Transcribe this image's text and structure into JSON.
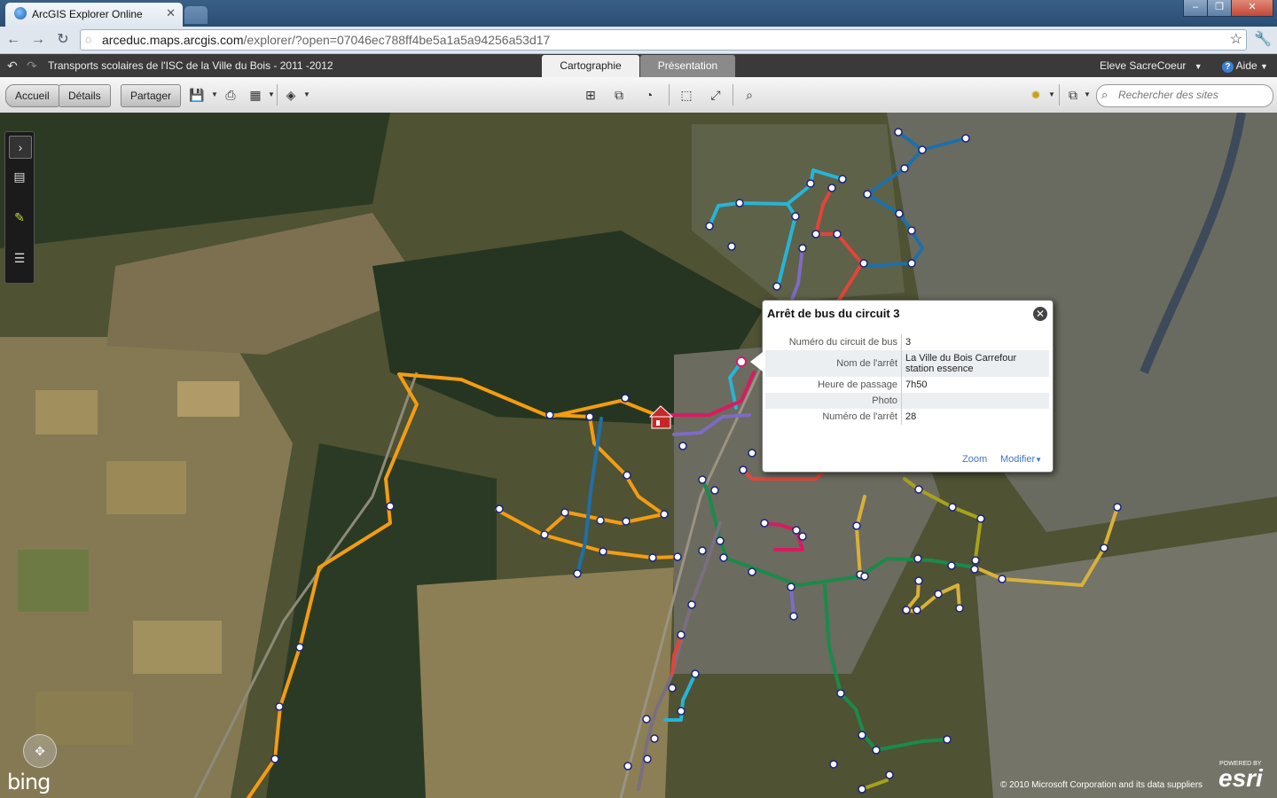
{
  "browser": {
    "tab_title": "ArcGIS Explorer Online",
    "url_host": "arceduc.maps.arcgis.com",
    "url_path": "/explorer/?open=07046ec788ff4be5a1a5a94256a53d17"
  },
  "app": {
    "title": "Transports scolaires de l'ISC de la Ville du Bois - 2011 -2012",
    "tabs": [
      "Cartographie",
      "Présentation"
    ],
    "active_tab": "Cartographie",
    "user": "Eleve SacreCoeur",
    "help": "Aide"
  },
  "toolbar": {
    "home": "Accueil",
    "details": "Détails",
    "share": "Partager",
    "search_placeholder": "Rechercher des sites"
  },
  "popup": {
    "title": "Arrêt de bus du circuit 3",
    "rows": [
      {
        "label": "Numéro du circuit de bus",
        "value": "3"
      },
      {
        "label": "Nom de l'arrêt",
        "value": "La Ville du Bois Carrefour station essence"
      },
      {
        "label": "Heure de passage",
        "value": "7h50"
      },
      {
        "label": "Photo",
        "value": ""
      },
      {
        "label": "Numéro de l'arrêt",
        "value": "28"
      }
    ],
    "zoom": "Zoom",
    "edit": "Modifier"
  },
  "map": {
    "provider": "bing",
    "copyright": "© 2010 Microsoft Corporation and its data suppliers",
    "powered_by": "POWERED BY",
    "esri": "esri"
  },
  "colors": {
    "orange_route": "#f39c12",
    "cyan_route": "#27b4d6",
    "blue_route": "#1f6fa8",
    "red_route": "#e2443a",
    "magenta_route": "#d81b60",
    "purple_route": "#7e6bc4",
    "green_route": "#1b8a4a",
    "olive_route": "#a6a21b",
    "gold_route": "#d8b13a",
    "gray_route": "#7a6f7e"
  }
}
